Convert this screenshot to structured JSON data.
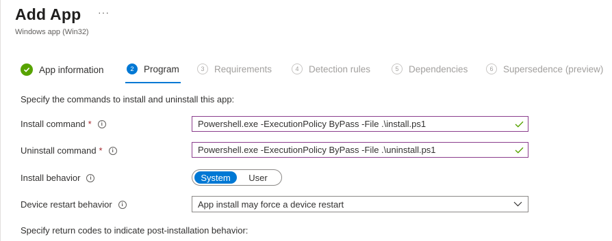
{
  "header": {
    "title": "Add App",
    "more_label": "···",
    "subtitle": "Windows app (Win32)"
  },
  "steps": [
    {
      "number": "",
      "label": "App information",
      "state": "completed"
    },
    {
      "number": "2",
      "label": "Program",
      "state": "active"
    },
    {
      "number": "3",
      "label": "Requirements",
      "state": "pending"
    },
    {
      "number": "4",
      "label": "Detection rules",
      "state": "pending"
    },
    {
      "number": "5",
      "label": "Dependencies",
      "state": "pending"
    },
    {
      "number": "6",
      "label": "Supersedence (preview)",
      "state": "pending"
    }
  ],
  "form": {
    "intro": "Specify the commands to install and uninstall this app:",
    "install_command": {
      "label": "Install command",
      "required": "*",
      "value": "Powershell.exe -ExecutionPolicy ByPass -File .\\install.ps1"
    },
    "uninstall_command": {
      "label": "Uninstall command",
      "required": "*",
      "value": "Powershell.exe -ExecutionPolicy ByPass -File .\\uninstall.ps1"
    },
    "install_behavior": {
      "label": "Install behavior",
      "options": [
        "System",
        "User"
      ],
      "selected": "System"
    },
    "device_restart": {
      "label": "Device restart behavior",
      "value": "App install may force a device restart"
    },
    "return_codes_intro": "Specify return codes to indicate post-installation behavior:"
  },
  "icons": {
    "info": "i",
    "valid_check_color": "#57a300"
  },
  "colors": {
    "accent": "#0078d4",
    "success": "#57a300",
    "required": "#a4262c",
    "field_border_focus": "#8a3c8c"
  }
}
